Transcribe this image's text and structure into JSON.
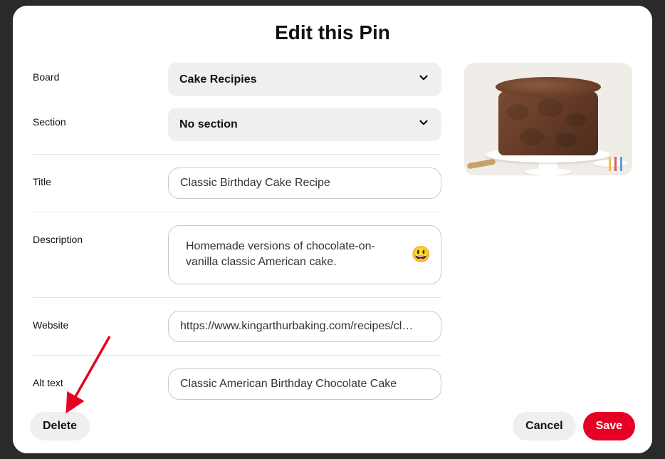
{
  "modal": {
    "title": "Edit this Pin"
  },
  "fields": {
    "board": {
      "label": "Board",
      "value": "Cake Recipies"
    },
    "section": {
      "label": "Section",
      "value": "No section"
    },
    "title": {
      "label": "Title",
      "value": "Classic Birthday Cake Recipe"
    },
    "description": {
      "label": "Description",
      "value": "Homemade versions of chocolate-on-vanilla classic American cake."
    },
    "website": {
      "label": "Website",
      "value": "https://www.kingarthurbaking.com/recipes/cl…"
    },
    "alt_text": {
      "label": "Alt text",
      "value": "Classic American Birthday Chocolate Cake"
    }
  },
  "icons": {
    "emoji": "😃"
  },
  "footer": {
    "delete": "Delete",
    "cancel": "Cancel",
    "save": "Save"
  },
  "annotation": {
    "arrow_color": "#e60023"
  }
}
